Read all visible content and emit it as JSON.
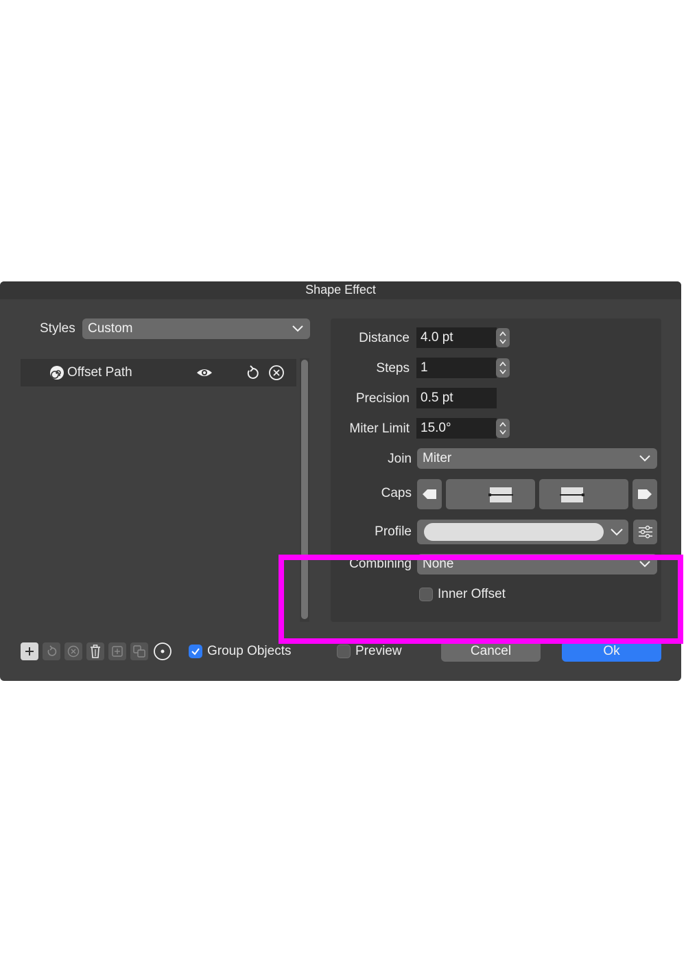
{
  "dialog": {
    "title": "Shape Effect",
    "styles_label": "Styles",
    "styles_value": "Custom",
    "effects": [
      {
        "label": "Offset Path"
      }
    ],
    "group_objects_label": "Group Objects",
    "preview_label": "Preview",
    "cancel_label": "Cancel",
    "ok_label": "Ok"
  },
  "settings": {
    "distance_label": "Distance",
    "distance_value": "4.0 pt",
    "steps_label": "Steps",
    "steps_value": "1",
    "precision_label": "Precision",
    "precision_value": "0.5 pt",
    "miter_limit_label": "Miter Limit",
    "miter_limit_value": "15.0°",
    "join_label": "Join",
    "join_value": "Miter",
    "caps_label": "Caps",
    "profile_label": "Profile",
    "combining_label": "Combining",
    "combining_value": "None",
    "inner_offset_label": "Inner Offset"
  },
  "icons": {
    "spiral": "spiral-icon",
    "eye": "eye-icon",
    "reset": "reset-icon",
    "close": "close-circle-icon",
    "add": "add-icon",
    "trash": "trash-icon",
    "settings": "sliders-icon"
  },
  "colors": {
    "dialog_bg": "#404040",
    "accent_blue": "#2f7cf6",
    "highlight": "#ff00ff"
  }
}
